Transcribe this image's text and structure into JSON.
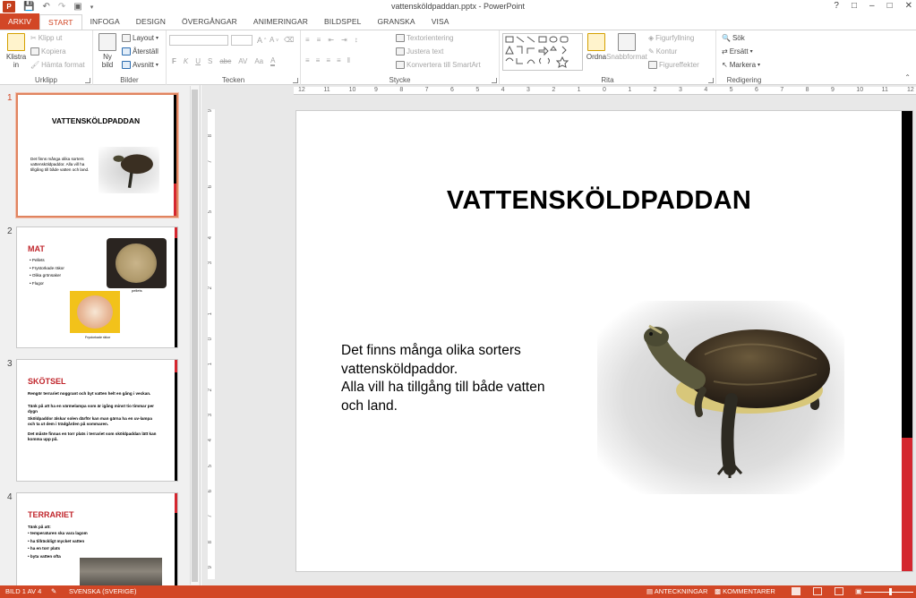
{
  "window": {
    "title": "vattensköldpaddan.pptx - PowerPoint",
    "app_icon": "P"
  },
  "tabs": [
    "ARKIV",
    "START",
    "INFOGA",
    "DESIGN",
    "ÖVERGÅNGAR",
    "ANIMERINGAR",
    "BILDSPEL",
    "GRANSKA",
    "VISA"
  ],
  "ribbon": {
    "clipboard": {
      "paste": "Klistra in",
      "cut": "Klipp ut",
      "copy": "Kopiera",
      "format_painter": "Hämta format",
      "label": "Urklipp"
    },
    "slides": {
      "new_slide": "Ny bild",
      "layout": "Layout",
      "reset": "Återställ",
      "section": "Avsnitt",
      "label": "Bilder"
    },
    "font": {
      "label": "Tecken"
    },
    "paragraph": {
      "text_direction": "Textorientering",
      "align_text": "Justera text",
      "smartart": "Konvertera till SmartArt",
      "label": "Stycke"
    },
    "drawing": {
      "arrange": "Ordna",
      "quick_styles": "Snabbformat",
      "fill": "Figurfyllning",
      "outline": "Kontur",
      "effects": "Figureffekter",
      "label": "Rita"
    },
    "editing": {
      "find": "Sök",
      "replace": "Ersätt",
      "select": "Markera",
      "label": "Redigering"
    }
  },
  "thumbnails": [
    {
      "num": "1",
      "title": "VATTENSKÖLDPADDAN",
      "text": "Det finns många olika sorters vattensköldpaddor. Alla vill ha tillgång till både vatten och land."
    },
    {
      "num": "2",
      "title": "MAT",
      "items": [
        "Pellets",
        "Frystorkade räkor",
        "Olika grönsaker",
        "Flugor"
      ],
      "caption1": "pellets",
      "caption2": "Frystorkade räkor"
    },
    {
      "num": "3",
      "title": "SKÖTSEL",
      "paras": [
        "Rengör terrariet noggrant och byt vatten helt en gång i veckan.",
        "Tänk på att ha en värmelampa som är igång minst tio timmar per dygn",
        "Sköldpaddor älskar solen därför kan man gärna ha en uv-lampa och ta ut dem i trädgården på sommaren.",
        "Det måste finnas en torr plats i terrariet som sköldpaddan lätt kan komma upp på."
      ]
    },
    {
      "num": "4",
      "title": "TERRARIET",
      "intro": "Tänk på att:",
      "items": [
        "temperaturen ska vara lagom",
        "ha tillräckligt mycket vatten",
        "ha en torr plats",
        "byta vatten ofta"
      ]
    }
  ],
  "slide": {
    "title": "VATTENSKÖLDPADDAN",
    "body_lines": [
      "Det finns många olika sorters",
      "vattensköldpaddor.",
      "Alla vill ha tillgång till både vatten",
      "och land."
    ]
  },
  "ruler": {
    "h_ticks": [
      "12",
      "11",
      "10",
      "9",
      "8",
      "7",
      "6",
      "5",
      "4",
      "3",
      "2",
      "1",
      "0",
      "1",
      "2",
      "3",
      "4",
      "5",
      "6",
      "7",
      "8",
      "9",
      "10",
      "11",
      "12"
    ],
    "v_ticks": [
      "9",
      "8",
      "7",
      "6",
      "5",
      "4",
      "3",
      "2",
      "1",
      "0",
      "1",
      "2",
      "3",
      "4",
      "5",
      "6",
      "7",
      "8",
      "9"
    ]
  },
  "status": {
    "slide_of": "BILD 1 AV 4",
    "language": "SVENSKA (SVERIGE)",
    "notes": "ANTECKNINGAR",
    "comments": "KOMMENTARER"
  },
  "colors": {
    "accent": "#d24726",
    "slide_red": "#d4272f",
    "slide_black": "#000000"
  }
}
